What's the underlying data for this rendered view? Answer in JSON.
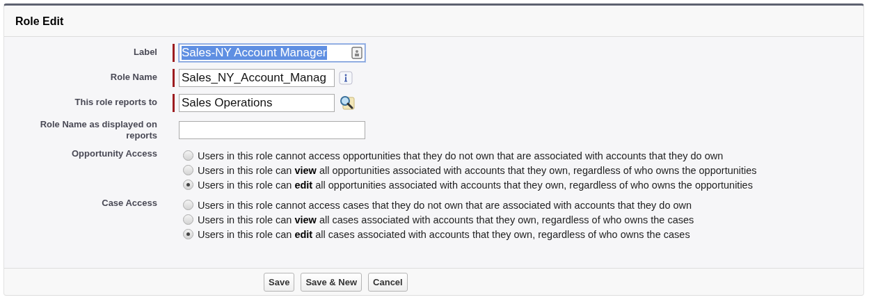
{
  "panel": {
    "title": "Role Edit"
  },
  "fields": [
    {
      "label": "Label",
      "value": "Sales-NY Account Manager",
      "required": true,
      "selected": true,
      "kind": "contact"
    },
    {
      "label": "Role Name",
      "value": "Sales_NY_Account_Manag",
      "required": true,
      "selected": false,
      "kind": "info"
    },
    {
      "label": "This role reports to",
      "value": "Sales Operations",
      "required": true,
      "selected": false,
      "kind": "lookup"
    },
    {
      "label": "Role Name as displayed on reports",
      "required": false,
      "selected": false,
      "kind": "plain"
    }
  ],
  "radio_groups": [
    {
      "label": "Opportunity Access",
      "options": [
        {
          "text": "Users in this role cannot access opportunities that they do not own that are associated with accounts that they do own",
          "selected": false
        },
        {
          "text": "Users in this role can **view** all opportunities associated with accounts that they own, regardless of who owns the opportunities",
          "selected": false
        },
        {
          "text": "Users in this role can **edit** all opportunities associated with accounts that they own, regardless of who owns the opportunities",
          "selected": true
        }
      ]
    },
    {
      "label": "Case Access",
      "options": [
        {
          "text": "Users in this role cannot access cases that they do not own that are associated with accounts that they do own",
          "selected": false
        },
        {
          "text": "Users in this role can **view** all cases associated with accounts that they own, regardless of who owns the cases",
          "selected": false
        },
        {
          "text": "Users in this role can **edit** all cases associated with accounts that they own, regardless of who owns the cases",
          "selected": true
        }
      ]
    }
  ],
  "buttons": [
    "Save",
    "Save & New",
    "Cancel"
  ]
}
